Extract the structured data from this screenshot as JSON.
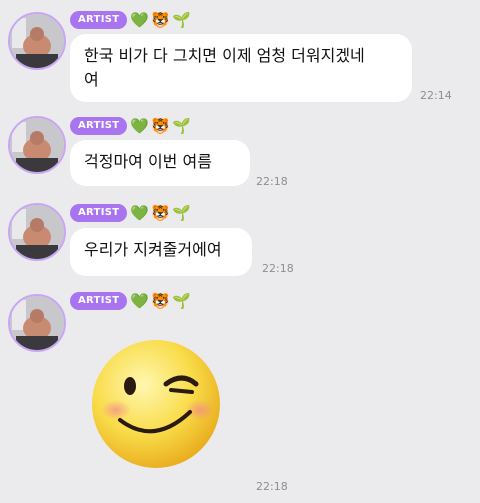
{
  "badge_label": "ARTIST",
  "badge_emojis": {
    "heart": "💚",
    "tiger": "🐯",
    "sprout": "🌱"
  },
  "messages": [
    {
      "text_line1": "한국 비가 다 그치면 이제 엄청 더워지겠네",
      "text_line2": "여",
      "time": "22:14"
    },
    {
      "text": "걱정마여 이번 여름",
      "time": "22:18"
    },
    {
      "text": "우리가 지켜줄거에여",
      "time": "22:18"
    },
    {
      "sticker": "winking-smiley-sticker",
      "time": "22:18"
    }
  ],
  "colors": {
    "background": "#ebebed",
    "badge": "#a874f0",
    "bubble": "#ffffff",
    "time": "#8e8e93"
  }
}
